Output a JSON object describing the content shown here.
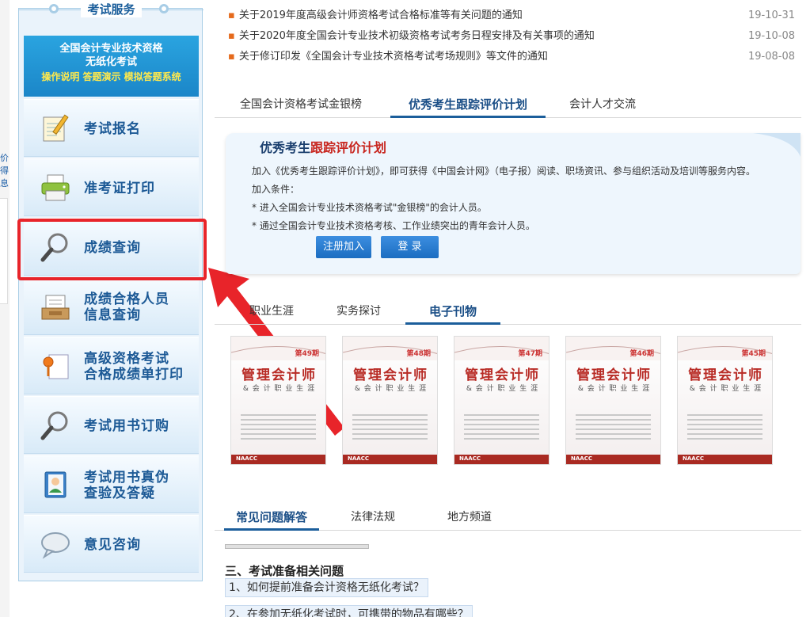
{
  "edge": {
    "fragment_lines": [
      "价",
      "得",
      "息"
    ]
  },
  "left_panel": {
    "title": "考试服务",
    "banner": {
      "line1": "全国会计专业技术资格",
      "line2": "无纸化考试",
      "line3": "操作说明 答题演示 模拟答题系统"
    },
    "menu": [
      {
        "label": "考试报名",
        "icon": "notepad-pencil-icon"
      },
      {
        "label": "准考证打印",
        "icon": "printer-icon"
      },
      {
        "label": "成绩查询",
        "icon": "magnifier-icon"
      },
      {
        "label": "成绩合格人员\n信息查询",
        "icon": "inbox-tray-icon"
      },
      {
        "label": "高级资格考试\n合格成绩单打印",
        "icon": "document-pin-icon"
      },
      {
        "label": "考试用书订购",
        "icon": "magnifier-icon"
      },
      {
        "label": "考试用书真伪\n查验及答疑",
        "icon": "contact-book-icon"
      },
      {
        "label": "意见咨询",
        "icon": "speech-bubble-icon"
      }
    ]
  },
  "news": [
    {
      "title": "关于2019年度高级会计师资格考试合格标准等有关问题的通知",
      "date": "19-10-31"
    },
    {
      "title": "关于2020年度全国会计专业技术初级资格考试考务日程安排及有关事项的通知",
      "date": "19-10-08"
    },
    {
      "title": "关于修订印发《全国会计专业技术资格考试考场规则》等文件的通知",
      "date": "19-08-08"
    }
  ],
  "tabs1": {
    "items": [
      "全国会计资格考试金银榜",
      "优秀考生跟踪评价计划",
      "会计人才交流"
    ],
    "active": 1
  },
  "card": {
    "title_a": "优秀考生",
    "title_b": "跟踪评价计划",
    "lines": [
      "加入《优秀考生跟踪评价计划》，即可获得《中国会计网》（电子报）阅读、职场资讯、参与组织活动及培训等服务内容。",
      "加入条件：",
      "* 进入全国会计专业技术资格考试\"金银榜\"的会计人员。",
      "* 通过全国会计专业技术资格考核、工作业绩突出的青年会计人员。"
    ],
    "register_label": "注册加入",
    "login_label": "登 录"
  },
  "tabs2": {
    "items": [
      "职业生涯",
      "实务探讨",
      "电子刊物"
    ],
    "active": 2
  },
  "magazines": [
    {
      "title": "管理会计师",
      "subtitle": "& 会 计 职 业 生 涯",
      "issue": "第49期"
    },
    {
      "title": "管理会计师",
      "subtitle": "& 会 计 职 业 生 涯",
      "issue": "第48期"
    },
    {
      "title": "管理会计师",
      "subtitle": "& 会 计 职 业 生 涯",
      "issue": "第47期"
    },
    {
      "title": "管理会计师",
      "subtitle": "& 会 计 职 业 生 涯",
      "issue": "第46期"
    },
    {
      "title": "管理会计师",
      "subtitle": "& 会 计 职 业 生 涯",
      "issue": "第45期"
    }
  ],
  "magazine_footer": "NAACC",
  "tabs3": {
    "items": [
      "常见问题解答",
      "法律法规",
      "地方频道"
    ],
    "active": 0
  },
  "faq": {
    "section": "三、考试准备相关问题",
    "items": [
      "1、如何提前准备会计资格无纸化考试？",
      "2、在参加无纸化考试时，可携带的物品有哪些？"
    ]
  },
  "colors": {
    "accent_blue": "#1b5e9b",
    "highlight_red": "#e8242a",
    "banner_yellow": "#ffe94d"
  }
}
